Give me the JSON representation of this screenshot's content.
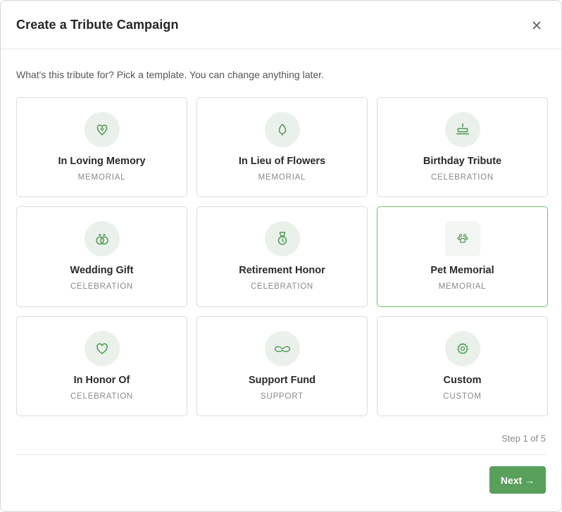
{
  "modal": {
    "title": "Create a Tribute Campaign",
    "close_label": "×",
    "subtitle": "What's this tribute for? Pick a template. You can change anything later."
  },
  "templates": [
    {
      "title": "In Loving Memory",
      "tag": "MEMORIAL",
      "icon": "heart-pin-icon"
    },
    {
      "title": "In Lieu of Flowers",
      "tag": "MEMORIAL",
      "icon": "leaf-icon"
    },
    {
      "title": "Birthday Tribute",
      "tag": "CELEBRATION",
      "icon": "cake-icon"
    },
    {
      "title": "Wedding Gift",
      "tag": "CELEBRATION",
      "icon": "rings-icon"
    },
    {
      "title": "Retirement Honor",
      "tag": "CELEBRATION",
      "icon": "medal-icon"
    },
    {
      "title": "Pet Memorial",
      "tag": "MEMORIAL",
      "icon": "paw-icon",
      "selected": true
    },
    {
      "title": "In Honor Of",
      "tag": "CELEBRATION",
      "icon": "heart-icon"
    },
    {
      "title": "Support Fund",
      "tag": "SUPPORT",
      "icon": "handshake-icon"
    },
    {
      "title": "Custom",
      "tag": "CUSTOM",
      "icon": "gear-icon"
    }
  ],
  "footer": {
    "step_label": "Step 1 of 5",
    "next_label": "Next →"
  },
  "colors": {
    "accent": "#58a05b",
    "icon_stroke": "#4e9a52",
    "icon_bg": "#eaf1ea",
    "selected_border": "#6fbf73"
  }
}
